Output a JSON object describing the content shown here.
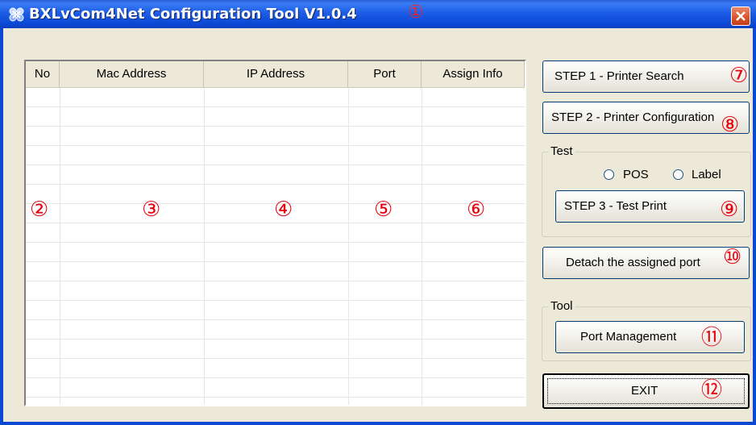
{
  "window": {
    "title": "BXLvCom4Net Configuration Tool V1.0.4",
    "title_marker": "①",
    "close_icon": "close-x-icon",
    "app_icon": "bixolon-app-icon"
  },
  "list": {
    "columns": [
      "No",
      "Mac Address",
      "IP Address",
      "Port",
      "Assign Info"
    ],
    "column_markers": [
      "②",
      "③",
      "④",
      "⑤",
      "⑥"
    ],
    "rows": []
  },
  "buttons": {
    "step1": {
      "label": "STEP 1 - Printer Search",
      "marker": "⑦"
    },
    "step2": {
      "label": "STEP 2 - Printer Configuration",
      "marker": "⑧"
    },
    "step3": {
      "label": "STEP 3 - Test Print",
      "marker": "⑨"
    },
    "detach": {
      "label": "Detach the assigned port",
      "marker": "⑩"
    },
    "port_management": {
      "label": "Port Management",
      "marker": "⑪"
    },
    "exit": {
      "label": "EXIT",
      "marker": "⑫"
    }
  },
  "test_group": {
    "label": "Test",
    "radio_pos": "POS",
    "radio_label": "Label"
  },
  "tool_group": {
    "label": "Tool"
  },
  "colors": {
    "title_bar": "#0b48d4",
    "marker": "#e8000b",
    "window_bg": "#ece9d8"
  }
}
